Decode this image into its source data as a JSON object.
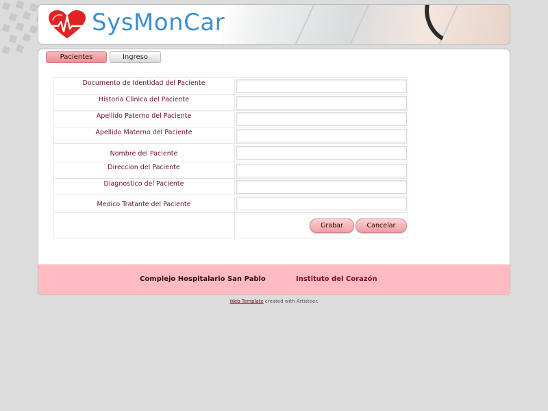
{
  "header": {
    "logo_text": "SysMonCar",
    "logo_icon": "heart-ecg-icon",
    "heart_color": "#e02424",
    "text_color": "#3f8fcf"
  },
  "tabs": [
    {
      "label": "Pacientes",
      "active": true
    },
    {
      "label": "Ingreso",
      "active": false
    }
  ],
  "form": {
    "fields": [
      {
        "label": "Documento de Identidad del Paciente",
        "value": ""
      },
      {
        "label": "Historia Clinica del Paciente",
        "value": ""
      },
      {
        "label": "Apellido Paterno del Paciente",
        "value": ""
      },
      {
        "label": "Apellido Materno del Paciente",
        "value": ""
      },
      {
        "label": "Nombre del Paciente",
        "value": ""
      },
      {
        "label": "Direccion del Paciente",
        "value": ""
      },
      {
        "label": "Diagnostico del Paciente",
        "value": ""
      },
      {
        "label": "Medico Tratante del Paciente",
        "value": ""
      }
    ],
    "save_label": "Grabar",
    "cancel_label": "Cancelar"
  },
  "footer": {
    "left": "Complejo Hospitalario San Pablo",
    "right": "Instituto del Corazón",
    "background": "#ffbbc1"
  },
  "credit": {
    "link_text": "Web Template",
    "suffix": " created with Artisteer."
  }
}
